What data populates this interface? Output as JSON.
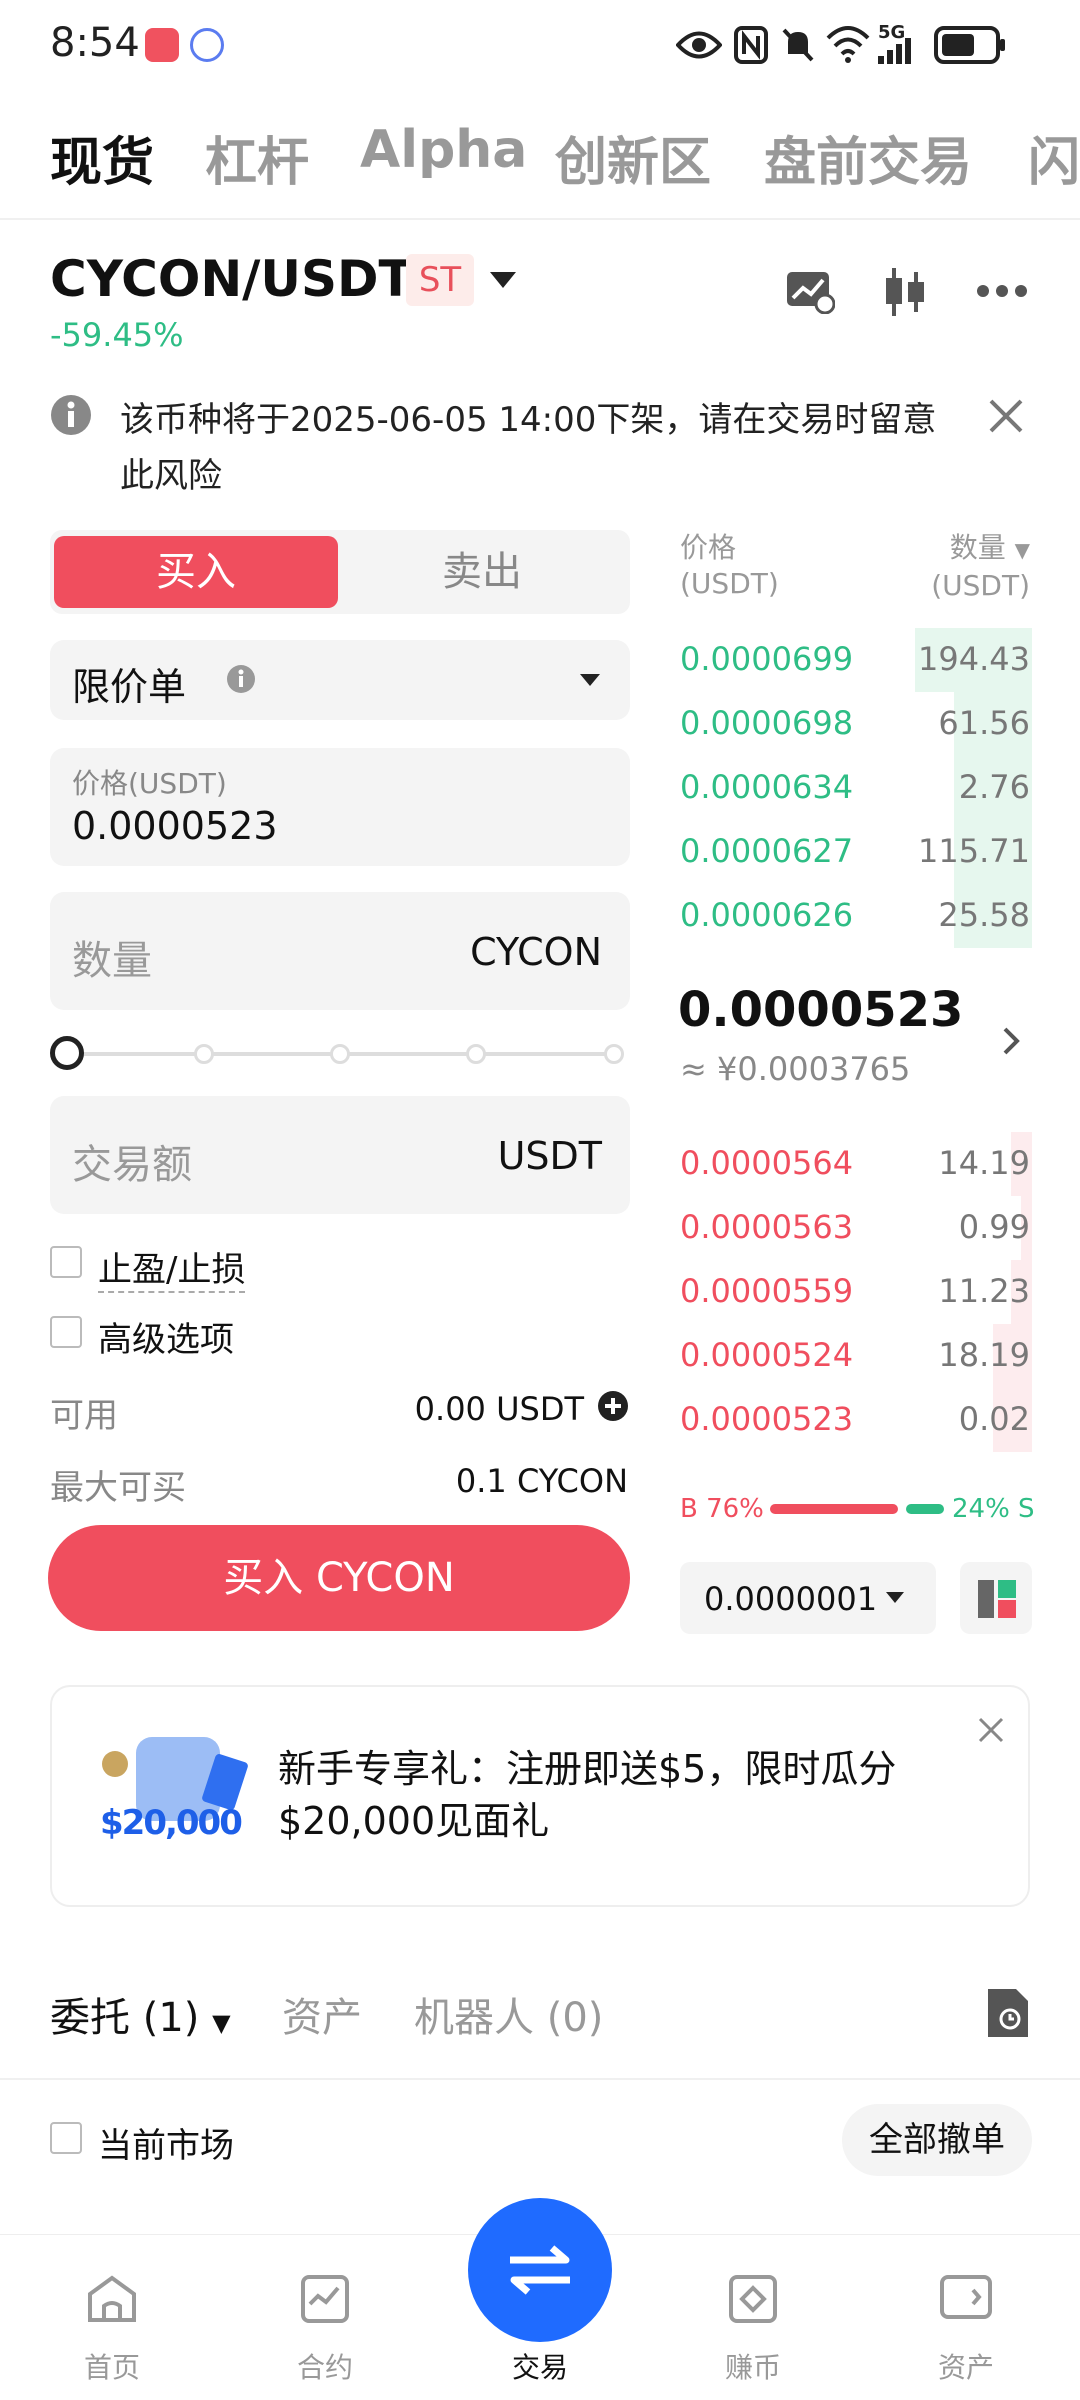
{
  "status": {
    "time": "8:54",
    "network": "5G"
  },
  "tabs": [
    "现货",
    "杠杆",
    "Alpha",
    "创新区",
    "盘前交易",
    "闪"
  ],
  "pair": {
    "symbol": "CYCON/USDT",
    "badge": "ST",
    "change": "-59.45%"
  },
  "notice": "该币种将于2025-06-05 14:00下架，请在交易时留意此风险",
  "order_form": {
    "buy_label": "买入",
    "sell_label": "卖出",
    "order_type": "限价单",
    "price_label": "价格(USDT)",
    "price_value": "0.0000523",
    "qty_placeholder": "数量",
    "qty_unit": "CYCON",
    "amount_placeholder": "交易额",
    "amount_unit": "USDT",
    "tpsl_label": "止盈/止损",
    "advanced_label": "高级选项",
    "available_label": "可用",
    "available_value": "0.00 USDT",
    "max_buy_label": "最大可买",
    "max_buy_value": "0.1 CYCON",
    "submit_label": "买入 CYCON",
    "slider_percent": 0
  },
  "orderbook": {
    "price_header": "价格",
    "price_unit": "(USDT)",
    "qty_header": "数量",
    "qty_unit": "(USDT)",
    "bids": [
      {
        "price": "0.0000699",
        "qty": "194.43",
        "depth": 0.33
      },
      {
        "price": "0.0000698",
        "qty": "61.56",
        "depth": 0.22
      },
      {
        "price": "0.0000634",
        "qty": "2.76",
        "depth": 0.22
      },
      {
        "price": "0.0000627",
        "qty": "115.71",
        "depth": 0.22
      },
      {
        "price": "0.0000626",
        "qty": "25.58",
        "depth": 0.22
      }
    ],
    "last_price": "0.0000523",
    "last_price_cny": "≈ ¥0.0003765",
    "asks": [
      {
        "price": "0.0000564",
        "qty": "14.19",
        "depth": 0.06
      },
      {
        "price": "0.0000563",
        "qty": "0.99",
        "depth": 0.03
      },
      {
        "price": "0.0000559",
        "qty": "11.23",
        "depth": 0.06
      },
      {
        "price": "0.0000524",
        "qty": "18.19",
        "depth": 0.11
      },
      {
        "price": "0.0000523",
        "qty": "0.02",
        "depth": 0.11
      }
    ],
    "buy_ratio_label": "B 76%",
    "sell_ratio_label": "24% S",
    "buy_ratio": 76,
    "precision": "0.0000001"
  },
  "promo": {
    "image_text": "$20,000",
    "title": "新手专享礼：注册即送$5，限时瓜分$20,000见面礼"
  },
  "bottom_tabs": {
    "orders": "委托 (1)",
    "assets": "资产",
    "bots": "机器人 (0)"
  },
  "filter": {
    "current_market": "当前市场",
    "cancel_all": "全部撤单"
  },
  "nav": [
    "首页",
    "合约",
    "交易",
    "赚币",
    "资产"
  ],
  "colors": {
    "green": "#2ebd85",
    "red": "#f04e5e",
    "blue": "#1f6bff"
  }
}
